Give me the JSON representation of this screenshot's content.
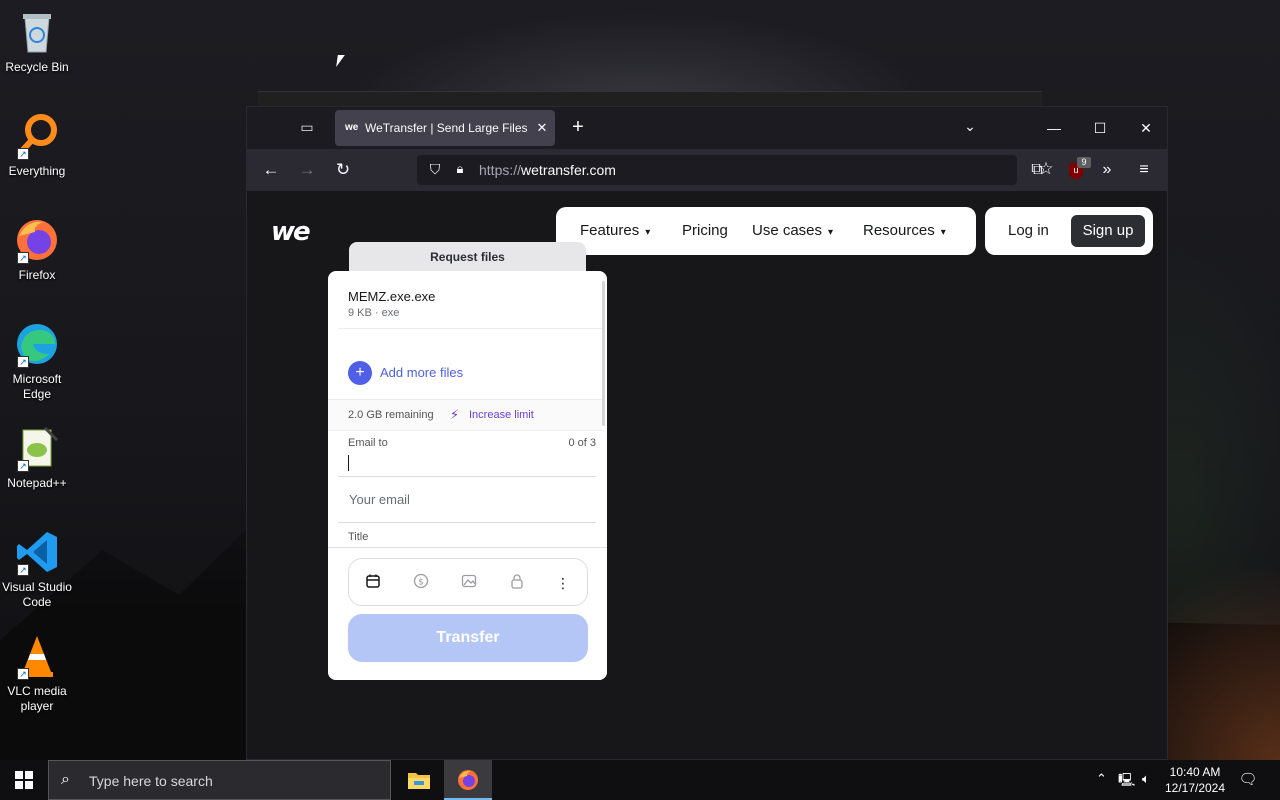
{
  "desktop": {
    "icons": [
      {
        "label": "Recycle Bin",
        "icon": "recycle-bin-icon"
      },
      {
        "label": "Everything",
        "icon": "everything-search-icon"
      },
      {
        "label": "Firefox",
        "icon": "firefox-icon"
      },
      {
        "label": "Microsoft Edge",
        "icon": "edge-icon"
      },
      {
        "label": "Notepad++",
        "icon": "notepadpp-icon"
      },
      {
        "label": "Visual Studio Code",
        "icon": "vscode-icon"
      },
      {
        "label": "VLC media player",
        "icon": "vlc-icon"
      }
    ]
  },
  "browser": {
    "tab_title": "WeTransfer | Send Large Files Fa",
    "url_protocol": "https://",
    "url_host": "wetransfer.com",
    "ublock_count": "9",
    "colors": {
      "chrome": "#2b2a33",
      "tab": "#42414d"
    }
  },
  "site": {
    "logo": "we",
    "nav": [
      "Features",
      "Pricing",
      "Use cases",
      "Resources"
    ],
    "login": "Log in",
    "signup": "Sign up",
    "request_tab": "Request files",
    "file": {
      "name": "MEMZ.exe.exe",
      "size": "9 KB",
      "type": "exe"
    },
    "add_more": "Add more files",
    "remaining": "2.0 GB remaining",
    "increase": "Increase limit",
    "email_to_label": "Email to",
    "email_to_count": "0 of 3",
    "your_email_placeholder": "Your email",
    "title_label": "Title",
    "transfer": "Transfer",
    "option_icons": [
      "calendar-icon",
      "dollar-icon",
      "image-icon",
      "lock-icon",
      "more-icon"
    ],
    "colors": {
      "accent": "#4f5fe6",
      "increase": "#6a3fd6",
      "transfer_disabled": "#b4c6f5"
    }
  },
  "taskbar": {
    "search_placeholder": "Type here to search",
    "time": "10:40 AM",
    "date": "12/17/2024"
  }
}
